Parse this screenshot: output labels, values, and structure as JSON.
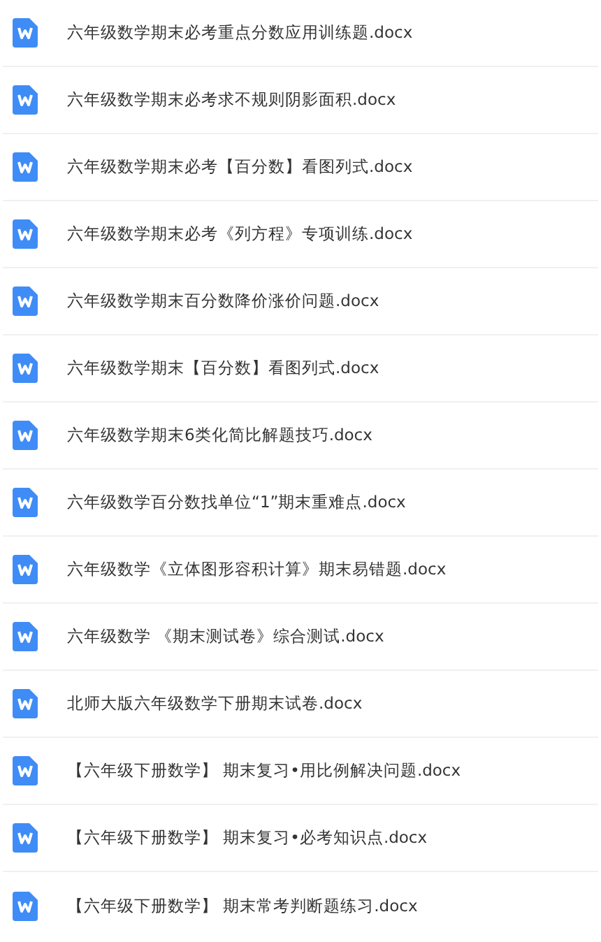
{
  "files": [
    {
      "name": "六年级数学期末必考重点分数应用训练题.docx"
    },
    {
      "name": "六年级数学期末必考求不规则阴影面积.docx"
    },
    {
      "name": "六年级数学期末必考【百分数】看图列式.docx"
    },
    {
      "name": "六年级数学期末必考《列方程》专项训练.docx"
    },
    {
      "name": "六年级数学期末百分数降价涨价问题.docx"
    },
    {
      "name": "六年级数学期末【百分数】看图列式.docx"
    },
    {
      "name": "六年级数学期末6类化简比解题技巧.docx"
    },
    {
      "name": "六年级数学百分数找单位“1”期末重难点.docx"
    },
    {
      "name": "六年级数学《立体图形容积计算》期末易错题.docx"
    },
    {
      "name": "六年级数学 《期末测试卷》综合测试.docx"
    },
    {
      "name": "北师大版六年级数学下册期末试卷.docx"
    },
    {
      "name": "【六年级下册数学】 期末复习•用比例解决问题.docx"
    },
    {
      "name": "【六年级下册数学】 期末复习•必考知识点.docx"
    },
    {
      "name": "【六年级下册数学】 期末常考判断题练习.docx"
    }
  ]
}
